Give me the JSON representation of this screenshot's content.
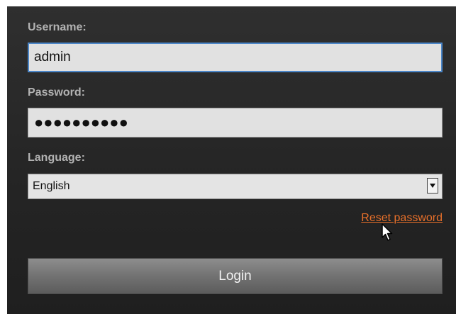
{
  "form": {
    "username_label": "Username:",
    "username_value": "admin",
    "password_label": "Password:",
    "password_masked": "●●●●●●●●●●",
    "language_label": "Language:",
    "language_selected": "English",
    "reset_link": "Reset password",
    "login_button": "Login"
  },
  "colors": {
    "accent_focus": "#4b86c8",
    "link": "#e8702a",
    "panel_bg": "#2a2a2a",
    "button_bg": "#737373"
  },
  "icons": {
    "select_arrow": "chevron-down-icon",
    "cursor": "mouse-pointer-icon"
  }
}
